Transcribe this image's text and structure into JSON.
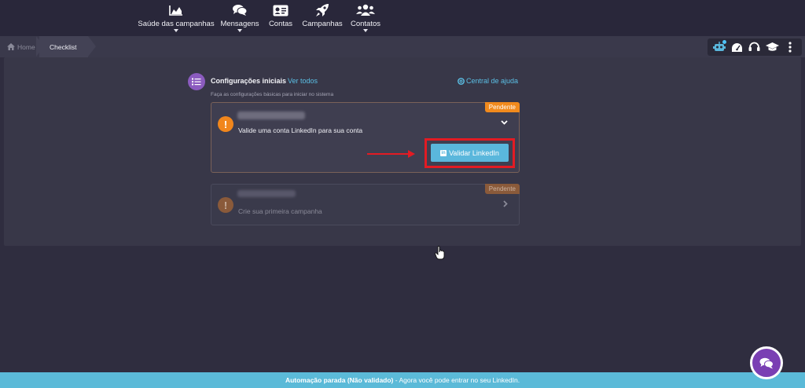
{
  "nav": {
    "items": [
      {
        "label": "Saúde das campanhas",
        "icon": "chart-area-icon",
        "caret": true
      },
      {
        "label": "Mensagens",
        "icon": "comments-icon",
        "caret": true
      },
      {
        "label": "Contas",
        "icon": "id-card-icon",
        "caret": false
      },
      {
        "label": "Campanhas",
        "icon": "rocket-icon",
        "caret": false
      },
      {
        "label": "Contatos",
        "icon": "users-icon",
        "caret": true
      }
    ]
  },
  "breadcrumb": {
    "home": "Home",
    "current": "Checklist"
  },
  "toolbar": {
    "icons": [
      "robot-icon",
      "speedometer-icon",
      "headset-icon",
      "graduation-cap-icon",
      "kebab-menu-icon"
    ]
  },
  "section": {
    "title": "Configurações iniciais",
    "see_all": "Ver todos",
    "help": "Central de ajuda",
    "subtitle": "Faça as configurações básicas para iniciar no sistema"
  },
  "cards": [
    {
      "status": "Pendente",
      "text": "Valide uma conta LinkedIn para sua conta",
      "button": "Validar LinkedIn",
      "expanded": true
    },
    {
      "status": "Pendente",
      "text": "Crie sua primeira campanha",
      "expanded": false
    }
  ],
  "footer": {
    "bold": "Automação parada (Não validado)",
    "text": " - Agora você pode entrar no seu LinkedIn."
  },
  "colors": {
    "accent": "#5ab7dc",
    "warning": "#f18a1d",
    "purple": "#8b5bbf",
    "highlight": "#e31b23"
  }
}
